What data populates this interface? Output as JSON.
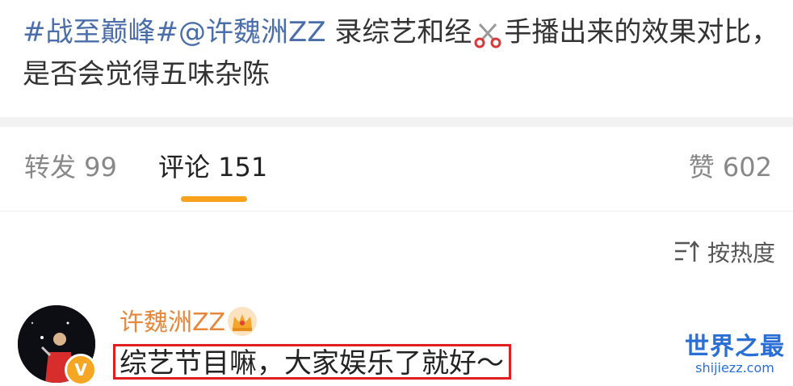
{
  "post": {
    "topic": "#战至巅峰#",
    "mention": "@许魏洲ZZ",
    "text_part1": " 录综艺和经",
    "text_part2": "手播出来的效果对比，",
    "text_line2": "是否会觉得五味杂陈",
    "emoji_icon": "scissors-icon"
  },
  "tabs": {
    "repost": "转发 99",
    "comment": "评论 151",
    "like": "赞 602",
    "active": "comment",
    "accent_color": "#f7a21a"
  },
  "sort": {
    "label": "按热度",
    "icon": "sort-icon"
  },
  "comment": {
    "username": "许魏洲ZZ",
    "text": "综艺节目嘛，大家娱乐了就好～",
    "badge": "V",
    "badge_icon": "verified-icon",
    "crown_icon": "crown-icon",
    "highlight_color": "#e02020"
  },
  "watermark": {
    "title": "世界之最",
    "url": "shijiezz.com"
  }
}
